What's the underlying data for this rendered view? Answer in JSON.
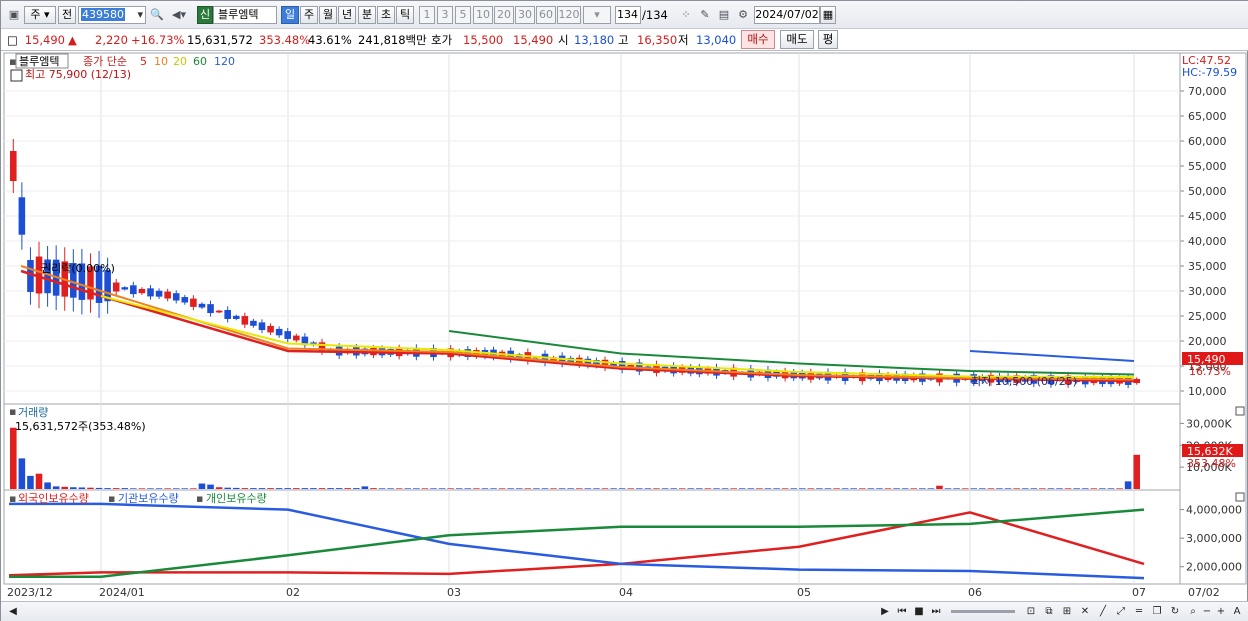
{
  "toolbar": {
    "market": "주",
    "prev": "전",
    "code": "439580",
    "badge": "신",
    "stock_name": "블루엠텍",
    "periods": [
      "일",
      "주",
      "월",
      "년",
      "분",
      "초",
      "틱"
    ],
    "active_period": "일",
    "counts": [
      "1",
      "3",
      "5",
      "10",
      "20",
      "30",
      "60",
      "120"
    ],
    "bar_count": "134",
    "bar_total": "/134",
    "date": "2024/07/02"
  },
  "quote": {
    "price": "15,490",
    "arrow": "▲",
    "change": "2,220",
    "change_pct": "+16.73%",
    "volume": "15,631,572",
    "vol_ratio": "353.48%",
    "turnover": "43.61%",
    "amount": "241,818백만",
    "hoga_label": "호가",
    "ask": "15,500",
    "bid": "15,490",
    "open_label": "시",
    "open": "13,180",
    "high_label": "고",
    "high": "16,350",
    "low_label": "저",
    "low": "13,040",
    "buy_button": "매수",
    "sell_button": "매도",
    "eval_button": "평"
  },
  "price_panel": {
    "stock_label": "블루엠텍",
    "ma_title": "종가 단순",
    "ma_periods": [
      "5",
      "10",
      "20",
      "60",
      "120"
    ],
    "ma_colors": [
      "#e02020",
      "#f08020",
      "#e8e800",
      "#1a8a3a",
      "#2a5ce0"
    ],
    "high_note": "최고 75,900 (12/13)",
    "low_note": "최저 10,500 (06/25)",
    "ex_rights_note": "권리락(0.00%)",
    "lc": "LC:47.52",
    "hc": "HC:-79.59",
    "current_price_tag": "15,490",
    "current_pct_tag": "16.73%",
    "y_ticks": [
      "70,000",
      "65,000",
      "60,000",
      "55,000",
      "50,000",
      "45,000",
      "40,000",
      "35,000",
      "30,000",
      "25,000",
      "20,000",
      "15,000",
      "10,000"
    ]
  },
  "volume_panel": {
    "title": "거래량",
    "last": "15,631,572주(353.48%)",
    "y_ticks": [
      "30,000K",
      "20,000K",
      "10,000K"
    ],
    "current_tag": "15,632K",
    "current_pct": "353.48%"
  },
  "holding_panel": {
    "legend": [
      "외국인보유수량",
      "기관보유수량",
      "개인보유수량"
    ],
    "colors": [
      "#e02020",
      "#2a5ce0",
      "#1a8a3a"
    ],
    "y_ticks": [
      "4,000,000",
      "3,000,000",
      "2,000,000"
    ]
  },
  "x_axis": {
    "labels": [
      "2023/12",
      "2024/01",
      "02",
      "03",
      "04",
      "05",
      "06",
      "07"
    ],
    "right_label": "07/02"
  },
  "chart_data": [
    {
      "type": "line",
      "title": "",
      "x": [
        "2023/12",
        "2024/01",
        "02",
        "03",
        "04",
        "05",
        "06",
        "07/02"
      ],
      "series": [
        {
          "name": "5",
          "values": [
            34000,
            29000,
            18000,
            17500,
            14500,
            13000,
            12500,
            12000
          ]
        },
        {
          "name": "10",
          "values": [
            35000,
            30000,
            18500,
            17800,
            14800,
            13200,
            12600,
            12300
          ]
        },
        {
          "name": "20",
          "values": [
            null,
            29000,
            19500,
            18200,
            15500,
            13800,
            12900,
            12800
          ]
        },
        {
          "name": "60",
          "values": [
            null,
            null,
            null,
            22000,
            17500,
            15500,
            14000,
            13300
          ]
        },
        {
          "name": "120",
          "values": [
            null,
            null,
            null,
            null,
            null,
            null,
            18000,
            16000
          ]
        }
      ],
      "ylim": [
        8000,
        76000
      ]
    },
    {
      "type": "bar",
      "title": "거래량",
      "values": [
        28000,
        14000,
        6000,
        7000,
        3000,
        1200,
        1000,
        800,
        700,
        600,
        500,
        400,
        400,
        400,
        300,
        300,
        300,
        300,
        300,
        300,
        300,
        300,
        2500,
        2000,
        800,
        600,
        500,
        400,
        400,
        400,
        400,
        400,
        400,
        400,
        400,
        400,
        400,
        400,
        400,
        400,
        400,
        1200,
        400,
        300,
        300,
        300,
        300,
        300,
        300,
        300,
        300,
        300,
        300,
        300,
        300,
        300,
        300,
        300,
        300,
        300,
        300,
        300,
        300,
        300,
        300,
        300,
        300,
        300,
        300,
        300,
        300,
        300,
        300,
        300,
        300,
        300,
        300,
        300,
        300,
        300,
        300,
        300,
        300,
        300,
        300,
        300,
        300,
        300,
        300,
        300,
        300,
        300,
        300,
        300,
        300,
        300,
        300,
        300,
        300,
        300,
        300,
        300,
        300,
        300,
        300,
        300,
        300,
        300,
        1500,
        300,
        300,
        300,
        300,
        300,
        300,
        300,
        300,
        300,
        300,
        300,
        300,
        300,
        300,
        300,
        300,
        300,
        300,
        300,
        300,
        300,
        3500,
        15632
      ],
      "ylim": [
        0,
        32000
      ]
    },
    {
      "type": "line",
      "title": "",
      "x": [
        "2023/12",
        "2024/01",
        "02",
        "03",
        "04",
        "05",
        "06",
        "07/02"
      ],
      "series": [
        {
          "name": "외국인보유수량",
          "values": [
            1700000,
            1800000,
            1800000,
            1750000,
            2100000,
            2700000,
            3900000,
            2100000
          ]
        },
        {
          "name": "기관보유수량",
          "values": [
            4200000,
            4200000,
            4000000,
            2800000,
            2100000,
            1900000,
            1850000,
            1600000
          ]
        },
        {
          "name": "개인보유수량",
          "values": [
            1650000,
            1650000,
            2400000,
            3100000,
            3400000,
            3400000,
            3500000,
            4000000
          ]
        }
      ],
      "ylim": [
        1500000,
        4300000
      ]
    }
  ]
}
